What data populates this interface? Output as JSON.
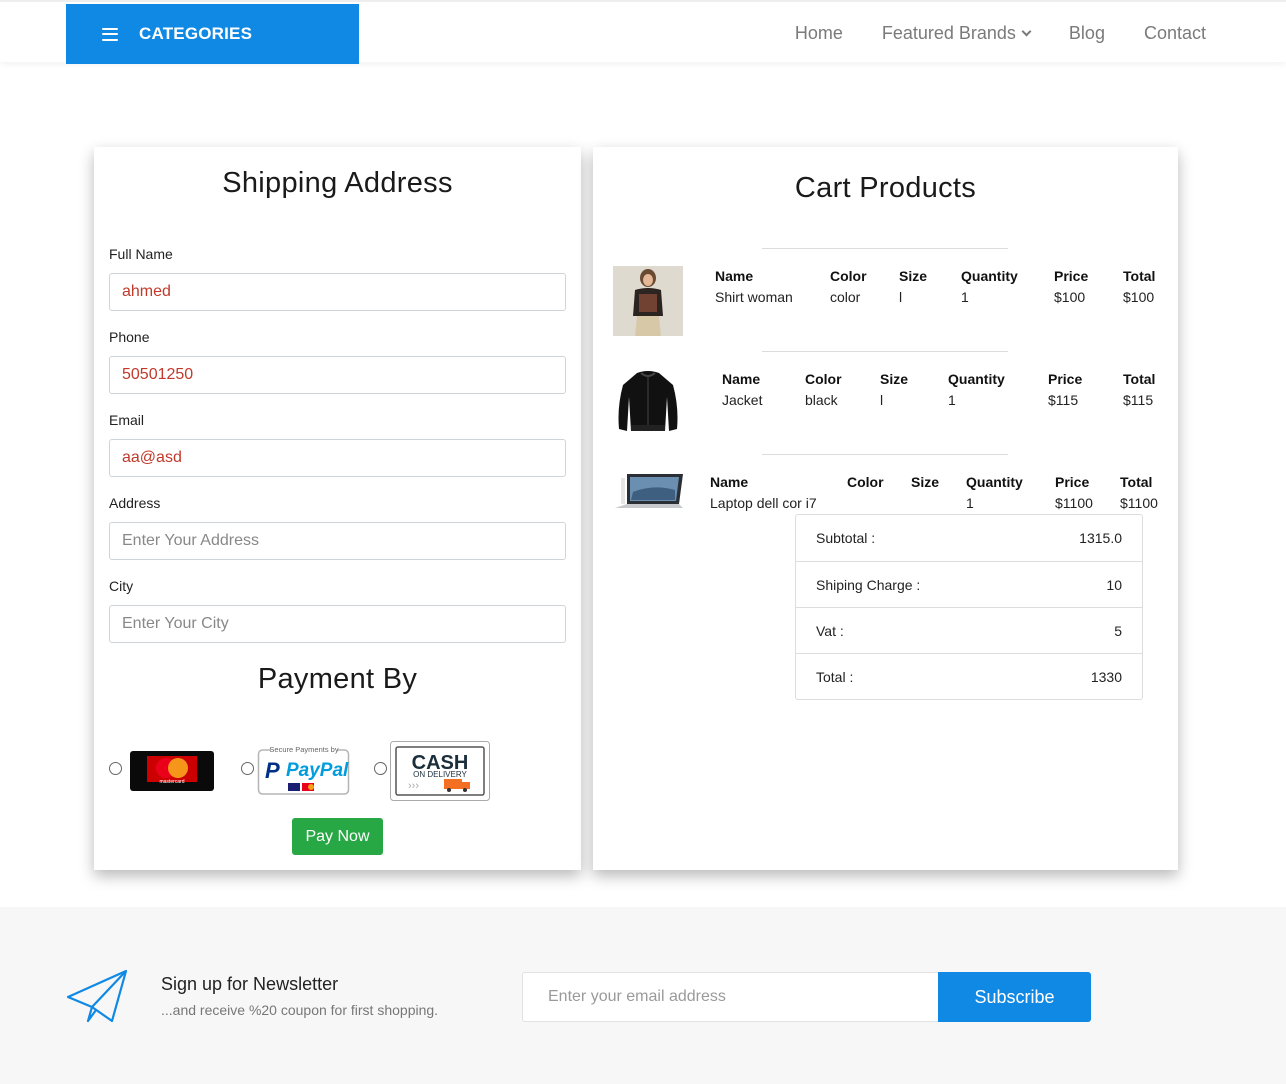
{
  "header": {
    "categories_label": "CATEGORIES",
    "nav": [
      {
        "label": "Home"
      },
      {
        "label": "Featured Brands"
      },
      {
        "label": "Blog"
      },
      {
        "label": "Contact"
      }
    ]
  },
  "shipping": {
    "title": "Shipping Address",
    "fields": {
      "full_name": {
        "label": "Full Name",
        "value": "ahmed",
        "placeholder": ""
      },
      "phone": {
        "label": "Phone",
        "value": "50501250",
        "placeholder": ""
      },
      "email": {
        "label": "Email",
        "value": "aa@asd",
        "placeholder": ""
      },
      "address": {
        "label": "Address",
        "value": "",
        "placeholder": "Enter Your Address"
      },
      "city": {
        "label": "City",
        "value": "",
        "placeholder": "Enter Your City"
      }
    },
    "payment_title": "Payment By",
    "payment_options": [
      {
        "name": "mastercard",
        "logo_text": "mastercard"
      },
      {
        "name": "paypal",
        "logo_text": "PayPal",
        "caption": "Secure Payments by"
      },
      {
        "name": "cash",
        "logo_text": "CASH",
        "caption": "ON DELIVERY"
      }
    ],
    "pay_now_label": "Pay Now"
  },
  "cart": {
    "title": "Cart Products",
    "headers": {
      "name": "Name",
      "color": "Color",
      "size": "Size",
      "quantity": "Quantity",
      "price": "Price",
      "total": "Total"
    },
    "items": [
      {
        "name": "Shirt woman",
        "color": "color",
        "size": "l",
        "quantity": "1",
        "price": "$100",
        "total": "$100",
        "thumb": "woman-shirt-photo"
      },
      {
        "name": "Jacket",
        "color": "black",
        "size": "l",
        "quantity": "1",
        "price": "$115",
        "total": "$115",
        "thumb": "black-jacket-photo"
      },
      {
        "name": "Laptop dell cor i7",
        "color": "",
        "size": "",
        "quantity": "1",
        "price": "$1100",
        "total": "$1100",
        "thumb": "laptop-photo"
      }
    ],
    "summary": [
      {
        "label": "Subtotal :",
        "value": "1315.0"
      },
      {
        "label": "Shiping Charge :",
        "value": "10"
      },
      {
        "label": "Vat :",
        "value": "5"
      },
      {
        "label": "Total :",
        "value": "1330"
      }
    ]
  },
  "newsletter": {
    "title": "Sign up for Newsletter",
    "subtitle": "...and receive %20 coupon for first shopping.",
    "email_placeholder": "Enter your email address",
    "subscribe_label": "Subscribe"
  },
  "colors": {
    "primary": "#1089e5",
    "success": "#28a745",
    "input_value": "#c0392b"
  }
}
